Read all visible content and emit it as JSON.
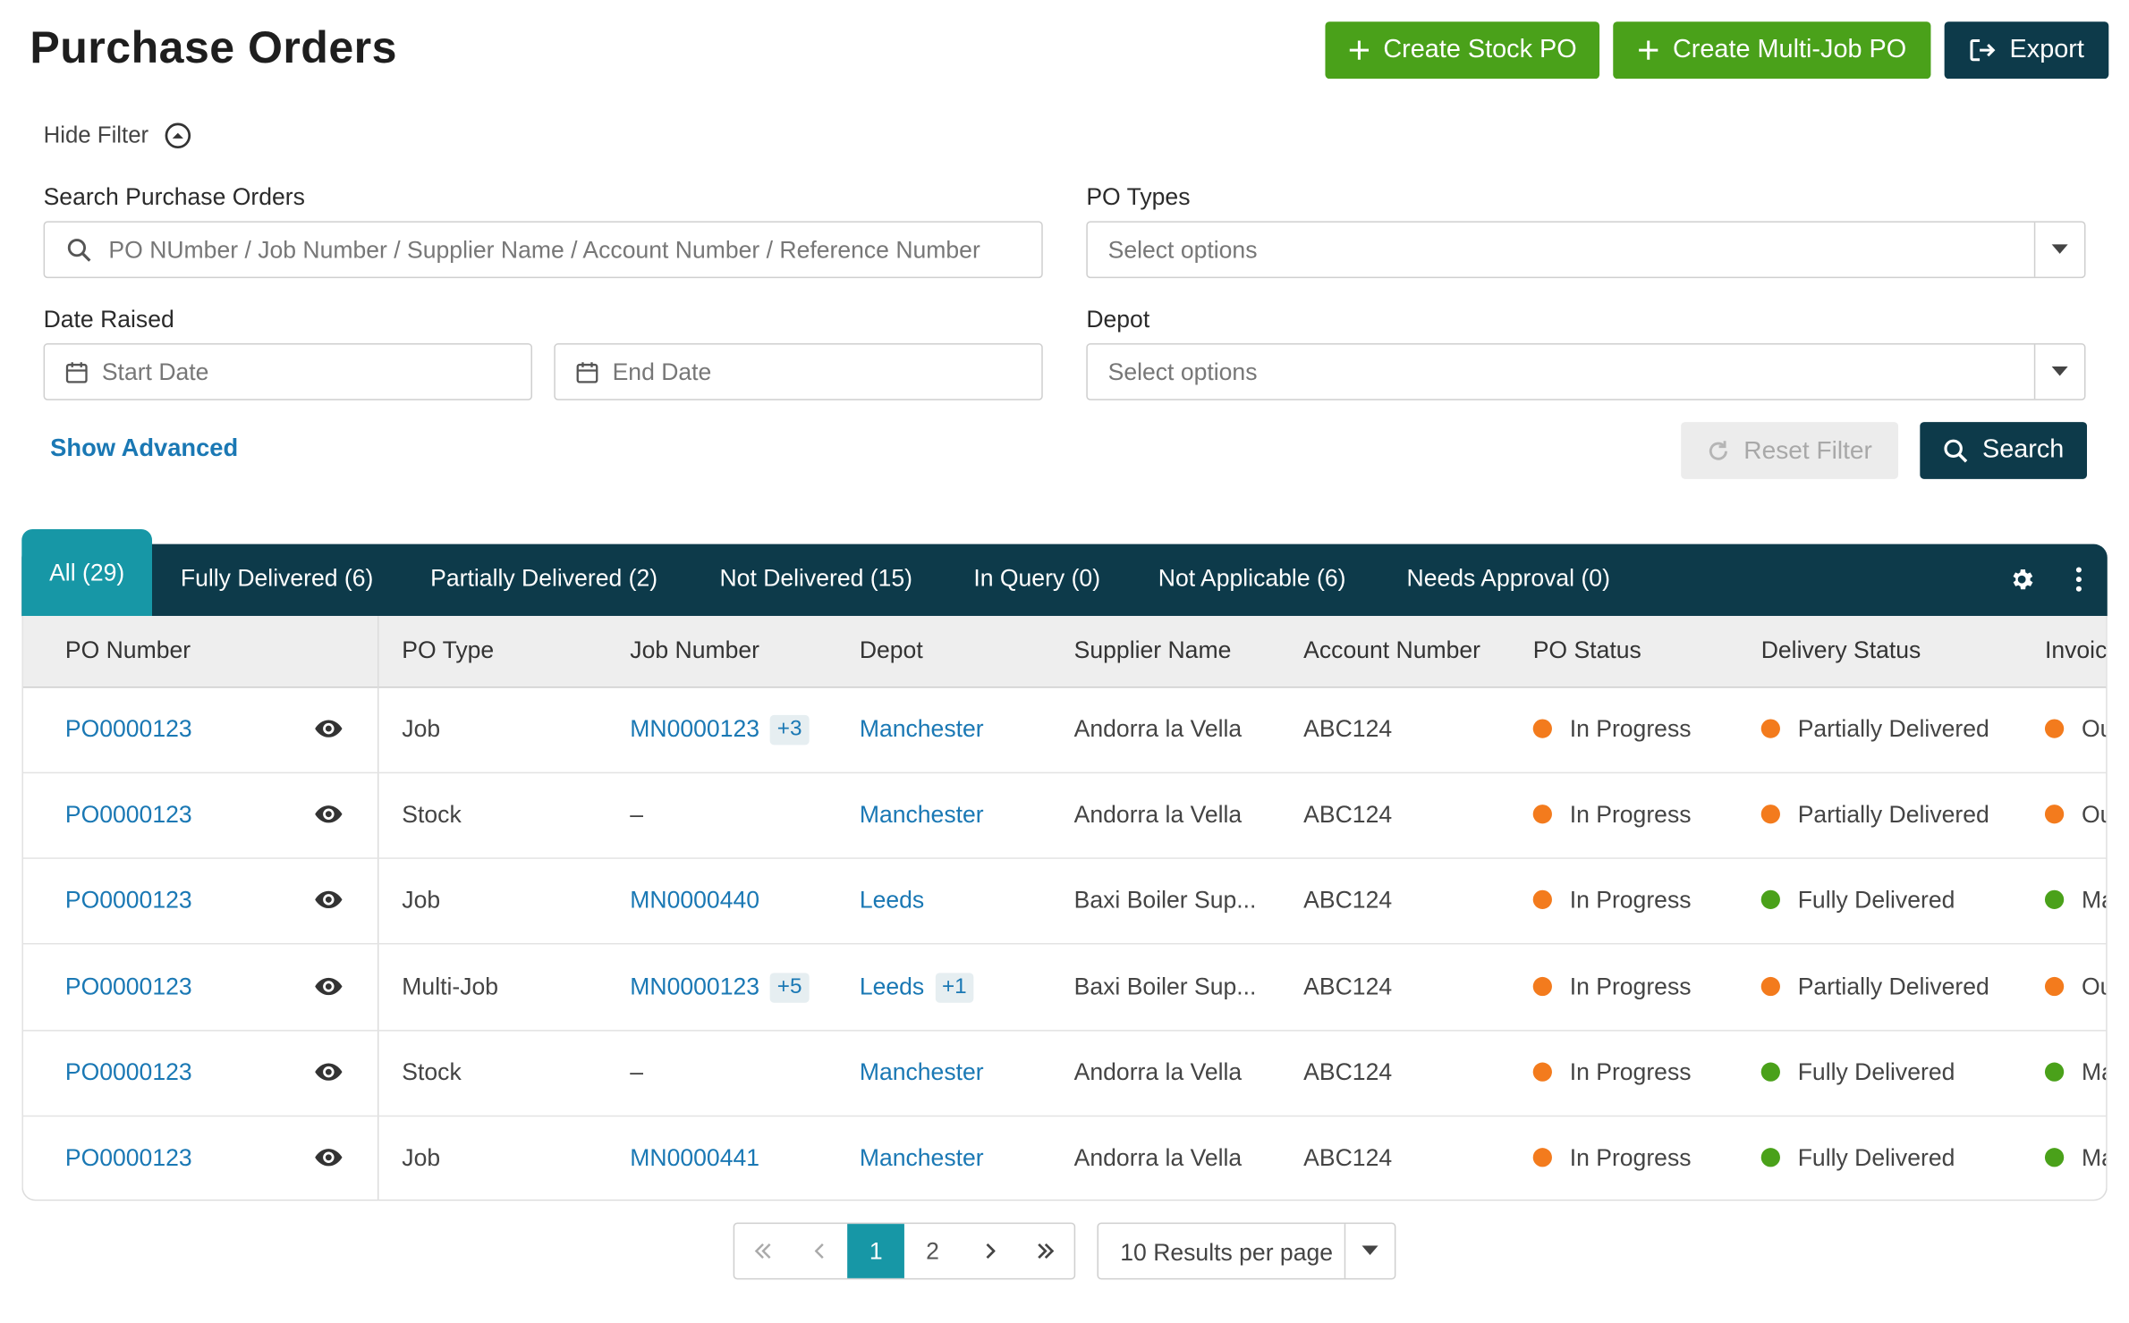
{
  "header": {
    "title": "Purchase Orders",
    "create_stock_label": "Create Stock PO",
    "create_multi_label": "Create Multi-Job PO",
    "export_label": "Export"
  },
  "filters": {
    "hide_filter_label": "Hide Filter",
    "search_label": "Search Purchase Orders",
    "search_placeholder": "PO NUmber / Job Number / Supplier Name / Account Number / Reference Number",
    "po_types_label": "PO Types",
    "po_types_placeholder": "Select options",
    "date_raised_label": "Date Raised",
    "start_date_placeholder": "Start Date",
    "end_date_placeholder": "End Date",
    "depot_label": "Depot",
    "depot_placeholder": "Select options",
    "show_advanced_label": "Show Advanced",
    "reset_label": "Reset Filter",
    "search_button_label": "Search"
  },
  "tabs": [
    {
      "label": "All (29)"
    },
    {
      "label": "Fully Delivered (6)"
    },
    {
      "label": "Partially Delivered (2)"
    },
    {
      "label": "Not Delivered (15)"
    },
    {
      "label": "In Query (0)"
    },
    {
      "label": "Not Applicable (6)"
    },
    {
      "label": "Needs Approval (0)"
    }
  ],
  "table": {
    "columns": [
      "PO Number",
      "PO Type",
      "Job Number",
      "Depot",
      "Supplier Name",
      "Account Number",
      "PO Status",
      "Delivery Status",
      "Invoic"
    ],
    "rows": [
      {
        "po": "PO0000123",
        "type": "Job",
        "job": "MN0000123",
        "job_extra": "+3",
        "depot": "Manchester",
        "depot_extra": "",
        "supplier": "Andorra la Vella",
        "account": "ABC124",
        "status": "In Progress",
        "status_color": "#f37b1d",
        "delivery": "Partially Delivered",
        "delivery_color": "#f37b1d",
        "invoice": "Ou",
        "invoice_color": "#f37b1d"
      },
      {
        "po": "PO0000123",
        "type": "Stock",
        "job": "–",
        "job_extra": "",
        "depot": "Manchester",
        "depot_extra": "",
        "supplier": "Andorra la Vella",
        "account": "ABC124",
        "status": "In Progress",
        "status_color": "#f37b1d",
        "delivery": "Partially Delivered",
        "delivery_color": "#f37b1d",
        "invoice": "Ou",
        "invoice_color": "#f37b1d"
      },
      {
        "po": "PO0000123",
        "type": "Job",
        "job": "MN0000440",
        "job_extra": "",
        "depot": "Leeds",
        "depot_extra": "",
        "supplier": "Baxi Boiler Sup...",
        "account": "ABC124",
        "status": "In Progress",
        "status_color": "#f37b1d",
        "delivery": "Fully Delivered",
        "delivery_color": "#4aa11a",
        "invoice": "Ma",
        "invoice_color": "#4aa11a"
      },
      {
        "po": "PO0000123",
        "type": "Multi-Job",
        "job": "MN0000123",
        "job_extra": "+5",
        "depot": "Leeds",
        "depot_extra": "+1",
        "supplier": "Baxi Boiler Sup...",
        "account": "ABC124",
        "status": "In Progress",
        "status_color": "#f37b1d",
        "delivery": "Partially Delivered",
        "delivery_color": "#f37b1d",
        "invoice": "Ou",
        "invoice_color": "#f37b1d"
      },
      {
        "po": "PO0000123",
        "type": "Stock",
        "job": "–",
        "job_extra": "",
        "depot": "Manchester",
        "depot_extra": "",
        "supplier": "Andorra la Vella",
        "account": "ABC124",
        "status": "In Progress",
        "status_color": "#f37b1d",
        "delivery": "Fully Delivered",
        "delivery_color": "#4aa11a",
        "invoice": "Ma",
        "invoice_color": "#4aa11a"
      },
      {
        "po": "PO0000123",
        "type": "Job",
        "job": "MN0000441",
        "job_extra": "",
        "depot": "Manchester",
        "depot_extra": "",
        "supplier": "Andorra la Vella",
        "account": "ABC124",
        "status": "In Progress",
        "status_color": "#f37b1d",
        "delivery": "Fully Delivered",
        "delivery_color": "#4aa11a",
        "invoice": "Ma",
        "invoice_color": "#4aa11a"
      }
    ]
  },
  "pagination": {
    "pages": [
      "1",
      "2"
    ],
    "current": "1",
    "per_page_label": "10 Results per page"
  },
  "colors": {
    "brand_dark": "#0d3a4a",
    "brand_teal": "#1797a6",
    "green": "#4aa11a",
    "orange": "#f37b1d",
    "link": "#1a78b4"
  },
  "icons": {
    "create_stock": "plus-icon",
    "create_multi": "plus-icon",
    "export": "export-icon",
    "hide_filter": "chevron-up-circle-icon",
    "search_field": "search-icon",
    "date": "calendar-icon",
    "select": "caret-down-icon",
    "reset": "refresh-icon",
    "search_button": "search-icon",
    "settings": "gear-icon",
    "menu": "kebab-icon",
    "view": "eye-icon",
    "first": "double-chevron-left-icon",
    "prev": "chevron-left-icon",
    "next": "chevron-right-icon",
    "last": "double-chevron-right-icon"
  }
}
